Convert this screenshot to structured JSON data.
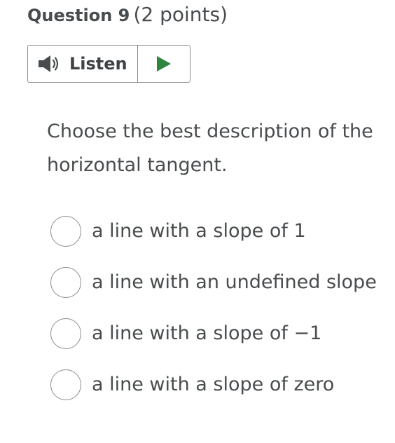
{
  "question": {
    "title": "Question 9",
    "points": "(2 points)"
  },
  "listen": {
    "label": "Listen",
    "speaker_icon": "speaker-icon",
    "play_icon": "play-icon",
    "play_color": "#2e8540"
  },
  "prompt": "Choose the best description of the horizontal tangent.",
  "options": [
    {
      "label": "a line with a slope of 1",
      "selected": false
    },
    {
      "label": "a line with an undefined slope",
      "selected": false
    },
    {
      "label": "a line with a slope of −1",
      "selected": false
    },
    {
      "label": "a line with a slope of zero",
      "selected": false
    }
  ]
}
